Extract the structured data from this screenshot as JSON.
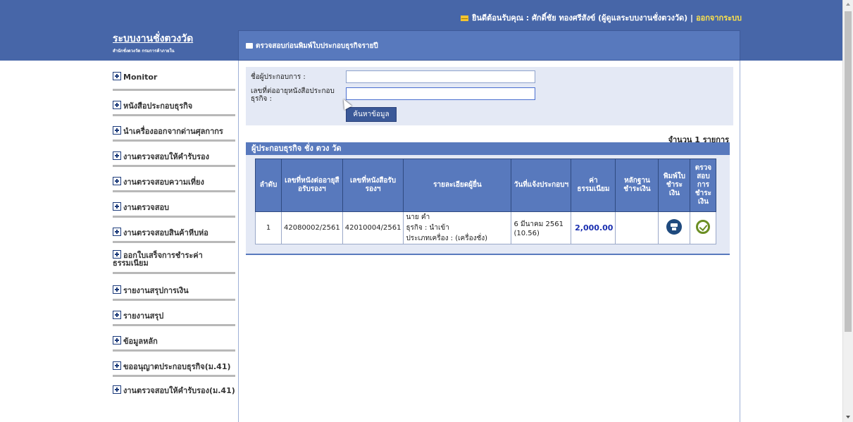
{
  "header": {
    "welcome": "ยินดีต้อนรับคุณ : ศักดิ์ชัย ทองศรีสังข์ (ผู้ดูแลระบบงานชั่งตวงวัด) |",
    "logout": "ออกจากระบบ",
    "logo_title": "ระบบงานชั่งตวงวัด",
    "logo_subtitle": "สำนักชั่งตวงวัด กรมการค้าภายใน"
  },
  "sidebar": {
    "items": [
      {
        "label": "Monitor"
      },
      {
        "label": "หนังสือประกอบธุรกิจ"
      },
      {
        "label": "นำเครื่องออกจากด่านศุลกากร"
      },
      {
        "label": "งานตรวจสอบให้คำรับรอง"
      },
      {
        "label": "งานตรวจสอบความเที่ยง"
      },
      {
        "label": "งานตรวจสอบ"
      },
      {
        "label": "งานตรวจสอบสินค้าหีบห่อ"
      },
      {
        "label": "ออกใบเสร็จการชำระค่าธรรมเนียม"
      },
      {
        "label": "รายงานสรุปการเงิน"
      },
      {
        "label": "รายงานสรุป"
      },
      {
        "label": "ข้อมูลหลัก"
      },
      {
        "label": "ขออนุญาตประกอบธุรกิจ(ม.41)"
      },
      {
        "label": "งานตรวจสอบให้คำรับรอง(ม.41)"
      }
    ]
  },
  "main": {
    "title": "ตรวจสอบก่อนพิมพ์ใบประกอบธุรกิจรายปี",
    "search": {
      "name_label": "ชื่อผู้ประกอบการ :",
      "name_value": "",
      "license_label": "เลขที่ต่ออายุหนังสือประกอบธุรกิจ :",
      "license_value": "",
      "button": "ค้นหาข้อมูล"
    },
    "count_text": "จำนวน 1 รายการ",
    "result_title": "ผู้ประกอบธุรกิจ ชั่ง ตวง วัด",
    "table": {
      "headers": [
        "ลำดับ",
        "เลขที่หนังต่ออายุสือรับรองฯ",
        "เลขที่หนังสือรับรองฯ",
        "รายละเอียดผู้ยื่น",
        "วันที่แจ้งประกอบฯ",
        "ค่าธรรมเนียม",
        "หลักฐานชำระเงิน",
        "พิมพ์ใบชำระเงิน",
        "ตรวจสอบการชำระเงิน"
      ],
      "rows": [
        {
          "no": "1",
          "renew_no": "42080002/2561",
          "cert_no": "42010004/2561",
          "detail_name": "นาย คำ",
          "detail_business": "ธุรกิจ : นำเข้า",
          "detail_type": "ประเภทเครื่อง : (เครื่องชั่ง)",
          "date": "6 มีนาคม 2561 (10.56)",
          "fee": "2,000.00",
          "evidence": ""
        }
      ]
    }
  },
  "colors": {
    "header_blue": "#4766a8",
    "panel_blue": "#5879bd",
    "panel_bg": "#e4e9f5",
    "amount_blue": "#1a2fb0",
    "check_green": "#6b8e23"
  },
  "icons": {
    "print": "printer-icon",
    "check": "check-circle-icon",
    "mail": "mail-icon",
    "plus": "plus-box-icon"
  }
}
